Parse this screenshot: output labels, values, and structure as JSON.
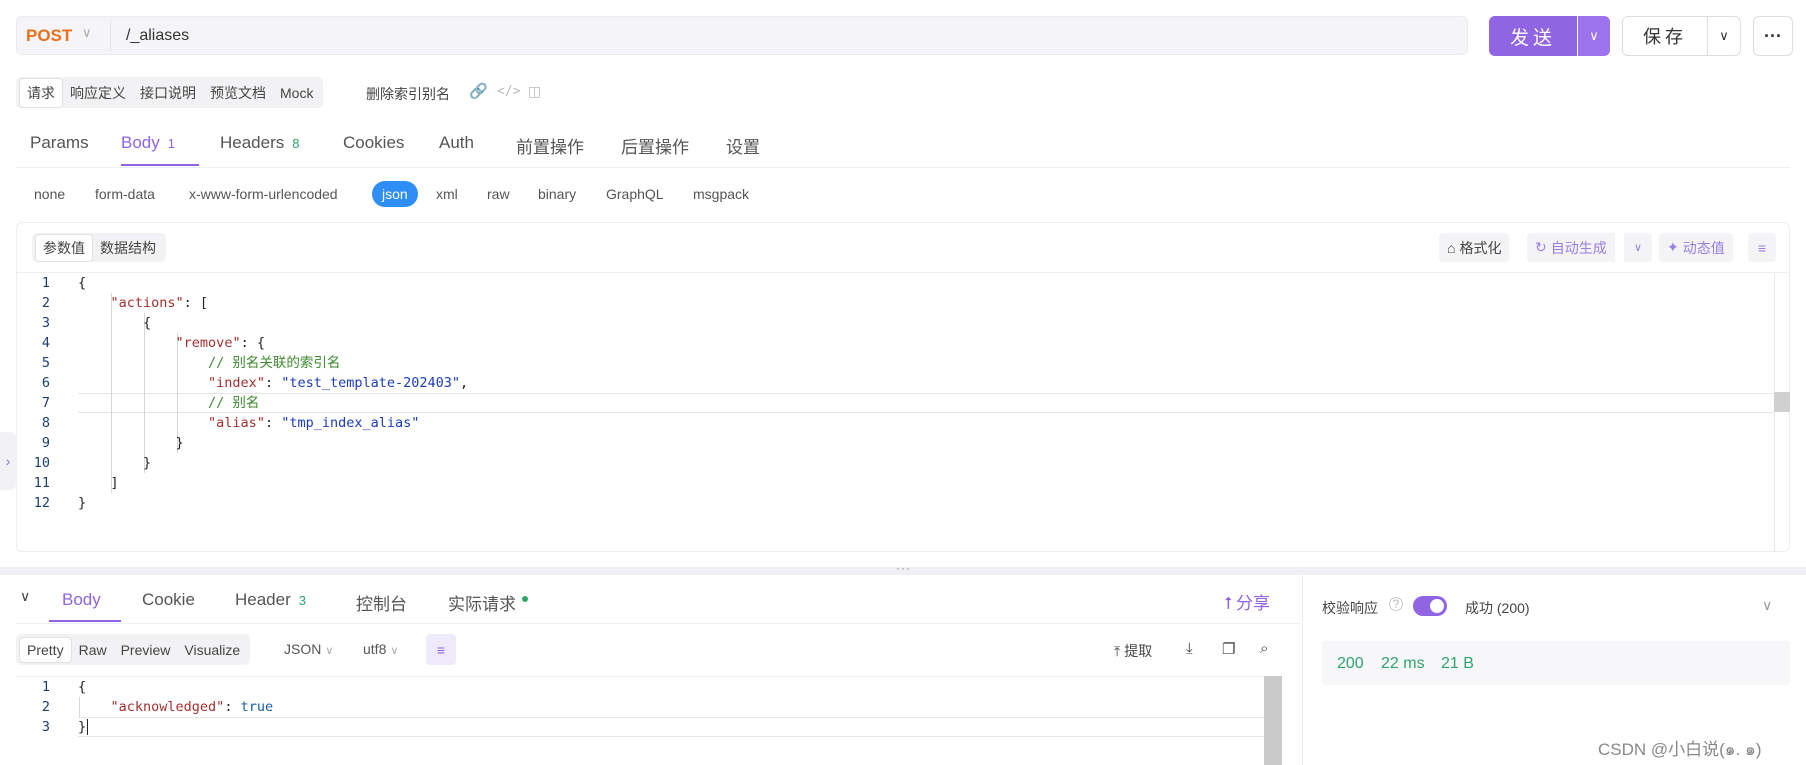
{
  "request": {
    "method": "POST",
    "url": "/_aliases",
    "send_label": "发送",
    "save_label": "保存"
  },
  "doc_tabs": [
    "请求",
    "响应定义",
    "接口说明",
    "预览文档",
    "Mock"
  ],
  "doc_tab_extra": "删除索引别名",
  "req_tabs": {
    "params": "Params",
    "body": "Body",
    "body_count": "1",
    "headers": "Headers",
    "headers_count": "8",
    "cookies": "Cookies",
    "auth": "Auth",
    "pre": "前置操作",
    "post": "后置操作",
    "settings": "设置"
  },
  "body_types": [
    "none",
    "form-data",
    "x-www-form-urlencoded",
    "json",
    "xml",
    "raw",
    "binary",
    "GraphQL",
    "msgpack"
  ],
  "body_type_selected": "json",
  "editor": {
    "value_tabs": [
      "参数值",
      "数据结构"
    ],
    "format_label": "格式化",
    "autogen_label": "自动生成",
    "dynamic_label": "动态值",
    "code": [
      "{",
      "    \"actions\": [",
      "        {",
      "            \"remove\": {",
      "                // 别名关联的索引名",
      "                \"index\": \"test_template-202403\",",
      "                // 别名",
      "                \"alias\": \"tmp_index_alias\"",
      "            }",
      "        }",
      "    ]",
      "}"
    ],
    "line_numbers": [
      "1",
      "2",
      "3",
      "4",
      "5",
      "6",
      "7",
      "8",
      "9",
      "10",
      "11",
      "12"
    ],
    "tokens": {
      "l2_key": "\"actions\"",
      "l4_key": "\"remove\"",
      "l5_comment": "// 别名关联的索引名",
      "l6_key": "\"index\"",
      "l6_val": "\"test_template-202403\"",
      "l7_comment": "// 别名",
      "l8_key": "\"alias\"",
      "l8_val": "\"tmp_index_alias\""
    }
  },
  "response": {
    "tabs": {
      "body": "Body",
      "cookie": "Cookie",
      "header": "Header",
      "header_count": "3",
      "console": "控制台",
      "actual": "实际请求"
    },
    "share_label": "分享",
    "format_tabs": [
      "Pretty",
      "Raw",
      "Preview",
      "Visualize"
    ],
    "format_select": "JSON",
    "encoding_select": "utf8",
    "extract_label": "提取",
    "line_numbers": [
      "1",
      "2",
      "3"
    ],
    "tokens": {
      "l2_key": "\"acknowledged\"",
      "l2_val": "true"
    }
  },
  "right_panel": {
    "verify_label": "校验响应",
    "status_label": "成功 (200)",
    "status_code": "200",
    "time": "22 ms",
    "size": "21 B",
    "toggle_on": true
  },
  "watermark": "CSDN @小白说(๑. ๑)",
  "colors": {
    "accent": "#9064e2",
    "method": "#e8711d",
    "json_selected": "#2f8ef5",
    "success": "#2ea56a"
  }
}
